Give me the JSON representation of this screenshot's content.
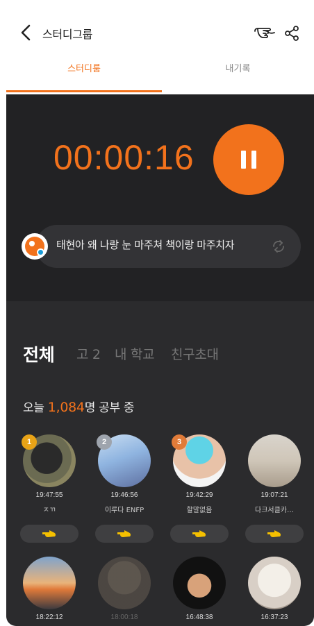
{
  "header": {
    "title": "스터디그룹",
    "icons": [
      "back-arrow-icon",
      "poke-hand-icon",
      "share-icon"
    ]
  },
  "tabs": [
    {
      "label": "스터디룸",
      "active": true
    },
    {
      "label": "내기록",
      "active": false
    }
  ],
  "timer": {
    "value": "00:00:16",
    "state": "running"
  },
  "message": {
    "text": "태현아 왜 나랑 눈 마주쳐 책이랑 마주치자"
  },
  "filters": [
    {
      "label": "전체",
      "active": true
    },
    {
      "label": "고 2",
      "active": false
    },
    {
      "label": "내 학교",
      "active": false
    },
    {
      "label": "친구초대",
      "active": false
    }
  ],
  "today": {
    "prefix": "오늘 ",
    "count": "1,084",
    "suffix": "명 공부 중"
  },
  "users": [
    {
      "rank": "1",
      "time": "19:47:55",
      "name": "ㅈㄲ"
    },
    {
      "rank": "2",
      "time": "19:46:56",
      "name": "이루다 ENFP"
    },
    {
      "rank": "3",
      "time": "19:42:29",
      "name": "할말없음"
    },
    {
      "rank": "",
      "time": "19:07:21",
      "name": "다크서클카…"
    },
    {
      "rank": "",
      "time": "18:22:12",
      "name": ""
    },
    {
      "rank": "",
      "time": "18:00:18",
      "name": ""
    },
    {
      "rank": "",
      "time": "16:48:38",
      "name": ""
    },
    {
      "rank": "",
      "time": "16:37:23",
      "name": ""
    }
  ],
  "colors": {
    "accent": "#f2721c",
    "dark_bg": "#222224",
    "panel_bg": "#2b2b2d",
    "gold": "#e8a317",
    "silver": "#9ea4ad",
    "bronze": "#e07b39"
  }
}
